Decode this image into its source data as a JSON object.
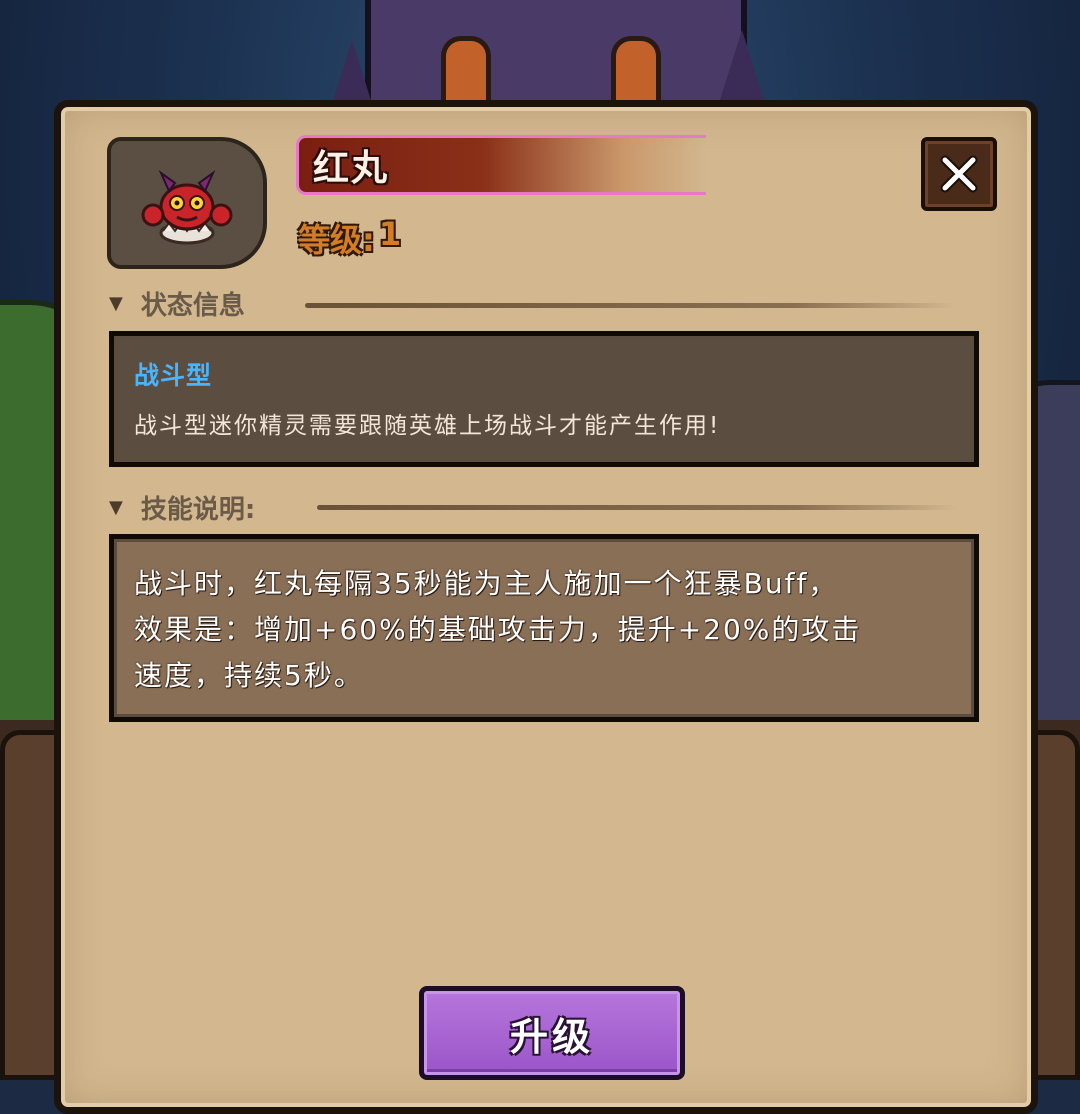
{
  "pet": {
    "name": "红丸",
    "level_label": "等级:",
    "level_value": "1",
    "portrait_icon": "red-crab-pet-icon"
  },
  "close_button": {
    "icon": "close-x-icon"
  },
  "status_section": {
    "heading": "状态信息",
    "type_name": "战斗型",
    "type_desc": "战斗型迷你精灵需要跟随英雄上场战斗才能产生作用!"
  },
  "skill_section": {
    "heading": "技能说明:",
    "lines": [
      "战斗时，红丸每隔35秒能为主人施加一个狂暴Buff，",
      "效果是：增加+60%的基础攻击力，提升+20%的攻击",
      "速度，持续5秒。"
    ]
  },
  "upgrade_button": {
    "label": "升级"
  },
  "colors": {
    "parchment": "#d2b78f",
    "title_bar": "#7b1e12",
    "title_border": "#e878c8",
    "type_name": "#49b4ff",
    "level": "#d37d26",
    "upgrade": "#a563d2"
  }
}
